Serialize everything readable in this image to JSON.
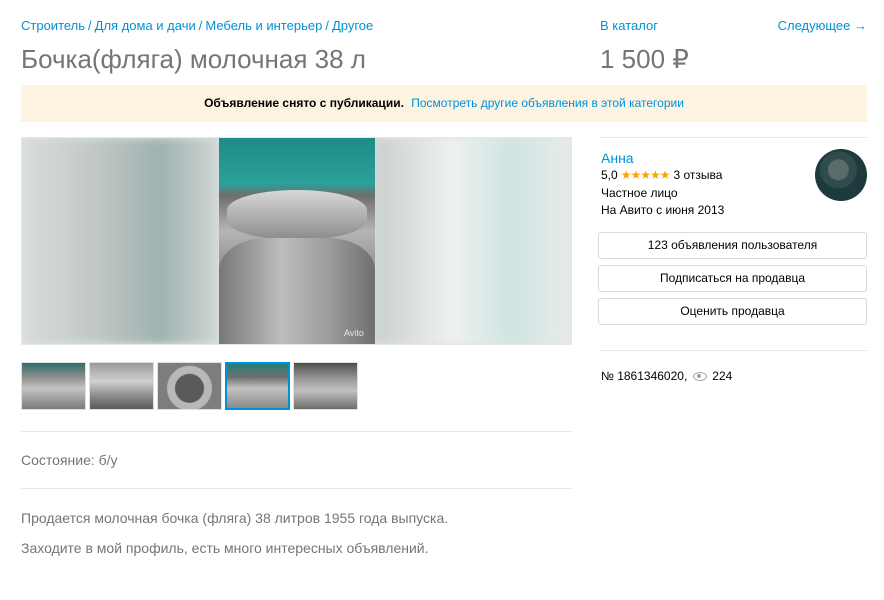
{
  "breadcrumbs": [
    "Строитель",
    "Для дома и дачи",
    "Мебель и интерьер",
    "Другое"
  ],
  "breadcrumb_separator": "/",
  "nav": {
    "catalog": "В каталог",
    "next": "Следующее →"
  },
  "title": "Бочка(фляга) молочная 38 л",
  "price": "1 500 ₽",
  "notice": {
    "bold": "Объявление снято с публикации.",
    "link": "Посмотреть другие объявления в этой категории"
  },
  "gallery": {
    "watermark": "Avito",
    "thumbnail_count": 5,
    "active_thumbnail": 4
  },
  "condition": "Состояние: б/у",
  "description": [
    "Продается молочная бочка (фляга) 38 литров 1955 года выпуска.",
    "Заходите в мой профиль, есть много интересных объявлений."
  ],
  "seller": {
    "name": "Анна",
    "rating": "5,0",
    "stars": "★★★★★",
    "reviews": "3 отзыва",
    "type": "Частное лицо",
    "since": "На Авито с июня 2013"
  },
  "buttons": {
    "ads": "123 объявления пользователя",
    "subscribe": "Подписаться на продавца",
    "rate": "Оценить продавца"
  },
  "ad_meta": {
    "number": "№ 1861346020,",
    "views": "224"
  },
  "colors": {
    "link": "#0091d9",
    "notice_bg": "#fdf3e1",
    "star": "#ffa200"
  }
}
